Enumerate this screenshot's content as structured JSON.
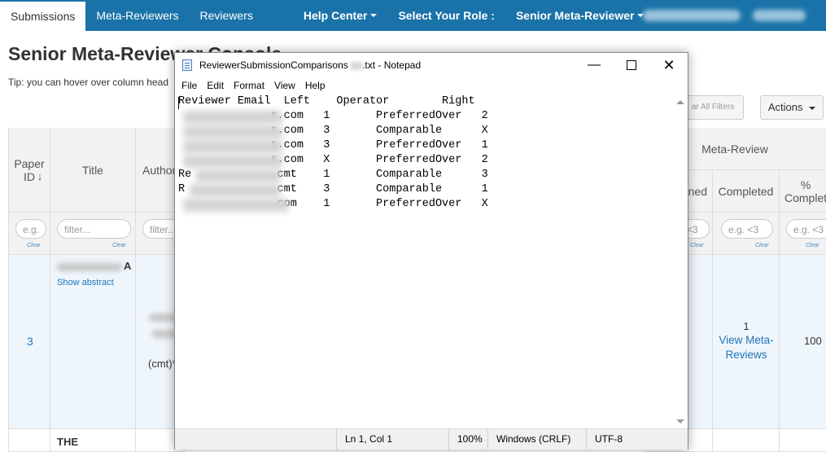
{
  "nav": {
    "tabs": [
      "Submissions",
      "Meta-Reviewers",
      "Reviewers"
    ],
    "help_center": "Help Center",
    "select_role": "Select Your Role :",
    "role": "Senior Meta-Reviewer"
  },
  "page": {
    "title": "Senior Meta-Reviewer Console",
    "tip": "Tip: you can hover over column head"
  },
  "toolbar": {
    "clear_filters": "ar All Filters",
    "actions": "Actions"
  },
  "table": {
    "headers": {
      "paper_id": "Paper ID",
      "title": "Title",
      "authors": "Author",
      "meta_review_group": "Meta-Review",
      "assigned": "ned",
      "completed": "Completed",
      "pct_completed": "% Complet"
    },
    "filters": {
      "paper_id_placeholder": "e.g.",
      "title_placeholder": "filter...",
      "authors_placeholder": "filter...",
      "assigned_placeholder": "<3",
      "completed_placeholder": "e.g. <3",
      "pct_placeholder": "e.g. <3",
      "clear": "Clear"
    },
    "rows": [
      {
        "paper_id": "3",
        "title_suffix": "A",
        "show_abstract": "Show abstract",
        "author_suffix": "(cmt)*",
        "completed_count": "1",
        "view_meta_reviews": "View Meta-Reviews",
        "pct": "100"
      },
      {
        "title": "THE"
      }
    ]
  },
  "notepad": {
    "title_prefix": "ReviewerSubmissionComparisons",
    "title_suffix": ".txt - Notepad",
    "menu": [
      "File",
      "Edit",
      "Format",
      "View",
      "Help"
    ],
    "lines": [
      "Reviewer Email  Left    Operator        Right",
      "              s.com   1       PreferredOver   2",
      "              s.com   3       Comparable      X",
      "              s.com   3       PreferredOver   1",
      "              s.com   X       PreferredOver   2",
      "Re            .cmt    1       Comparable      3",
      "R             .cmt    3       Comparable      1",
      "              .com    1       PreferredOver   X"
    ],
    "status": {
      "position": "Ln 1, Col 1",
      "zoom": "100%",
      "line_ending": "Windows (CRLF)",
      "encoding": "UTF-8"
    }
  }
}
